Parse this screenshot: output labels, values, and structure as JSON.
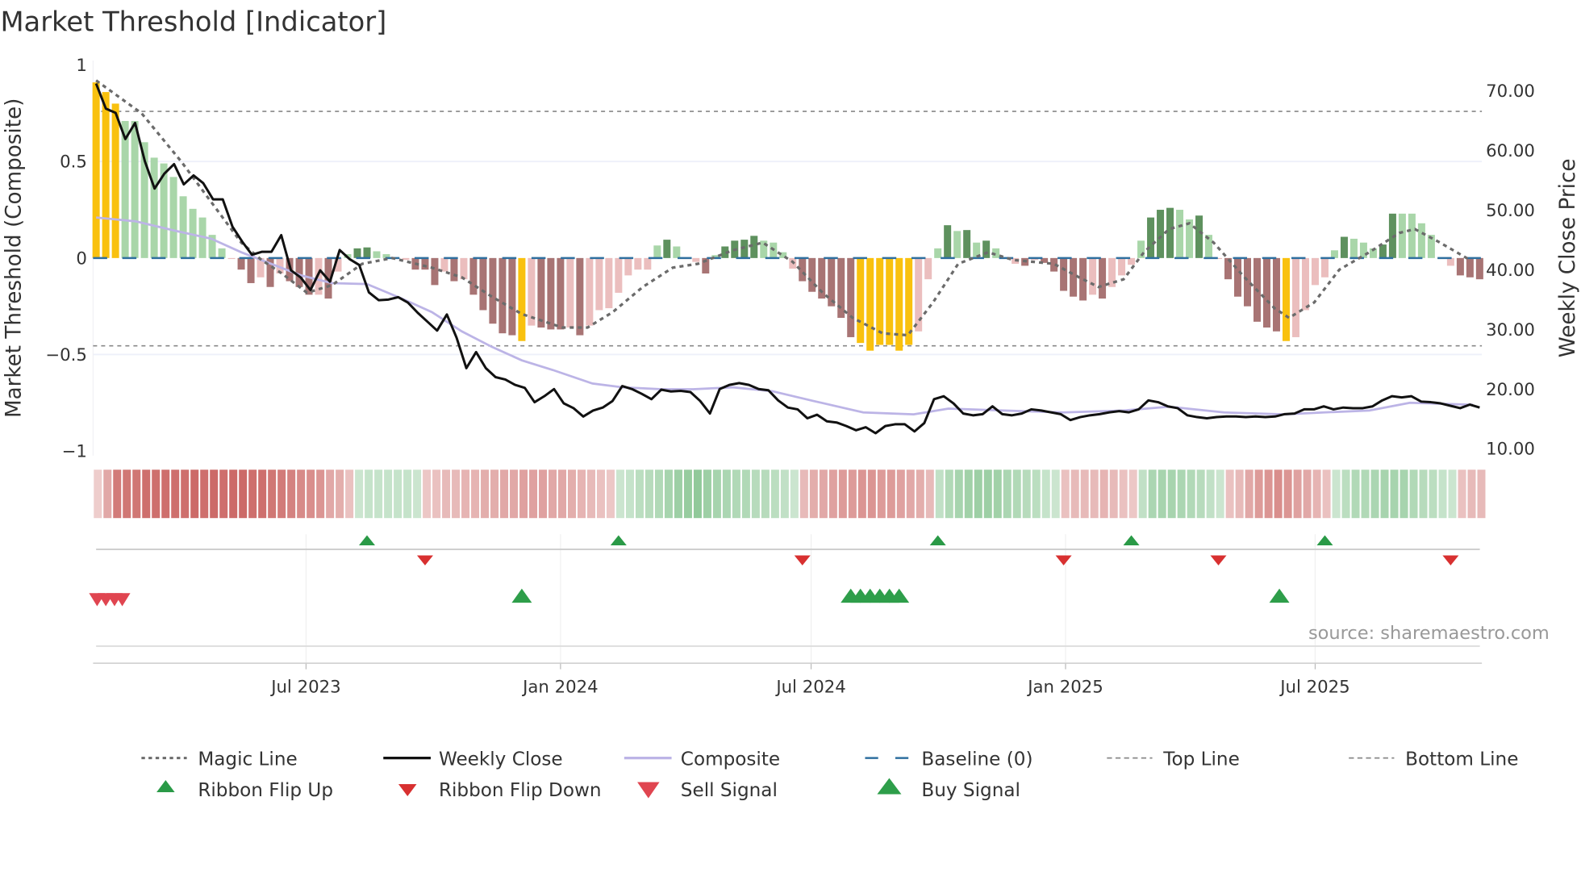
{
  "chart_data": {
    "type": "bar",
    "title": "Market Threshold [Indicator]",
    "ylabel_left": "Market Threshold (Composite)",
    "ylabel_right": "Weekly Close Price",
    "ylim_left": [
      -1,
      1
    ],
    "ylim_right": [
      10,
      73
    ],
    "left_ticks": [
      "1",
      "0.5",
      "0",
      "−0.5",
      "−1"
    ],
    "left_tick_values": [
      1,
      0.5,
      0,
      -0.5,
      -1
    ],
    "right_ticks": [
      "70.00",
      "60.00",
      "50.00",
      "40.00",
      "30.00",
      "20.00",
      "10.00"
    ],
    "right_tick_values": [
      70,
      60,
      50,
      40,
      30,
      20,
      10
    ],
    "x_ticks": [
      {
        "label": "Jul 2023",
        "week": 21.7
      },
      {
        "label": "Jan 2024",
        "week": 48.0
      },
      {
        "label": "Jul 2024",
        "week": 73.9
      },
      {
        "label": "Jan 2025",
        "week": 100.2
      },
      {
        "label": "Jul 2025",
        "week": 126.0
      }
    ],
    "top_line": 0.76,
    "bottom_line": -0.455,
    "baseline": 0,
    "colors": {
      "extreme": "#f9c10e",
      "strong_up": "#5e915e",
      "weak_up": "#a9d6a9",
      "strong_down": "#a87474",
      "weak_down": "#ebbebe",
      "baseline": "#2f6f9f",
      "composite": "#bcb4e6",
      "close": "#111111",
      "magic": "#6b6b6b",
      "ribbon_up": "#6fb87a",
      "ribbon_down": "#c4524f",
      "flip_up": "#2a9a47",
      "flip_down": "#d83030",
      "sell": "#e04550",
      "buy": "#2e9e4a"
    },
    "histogram_types": "Y=extreme, G=strong up, g=weak up, R=strong down, r=weak down",
    "histogram": [
      [
        0.91,
        "Y"
      ],
      [
        0.86,
        "Y"
      ],
      [
        0.8,
        "Y"
      ],
      [
        0.71,
        "g"
      ],
      [
        0.71,
        "g"
      ],
      [
        0.6,
        "g"
      ],
      [
        0.52,
        "g"
      ],
      [
        0.49,
        "g"
      ],
      [
        0.42,
        "g"
      ],
      [
        0.32,
        "g"
      ],
      [
        0.255,
        "g"
      ],
      [
        0.21,
        "g"
      ],
      [
        0.12,
        "g"
      ],
      [
        0.05,
        "g"
      ],
      [
        -0.005,
        "r"
      ],
      [
        -0.06,
        "R"
      ],
      [
        -0.13,
        "R"
      ],
      [
        -0.1,
        "r"
      ],
      [
        -0.15,
        "R"
      ],
      [
        -0.08,
        "r"
      ],
      [
        -0.12,
        "R"
      ],
      [
        -0.15,
        "R"
      ],
      [
        -0.19,
        "R"
      ],
      [
        -0.19,
        "r"
      ],
      [
        -0.21,
        "R"
      ],
      [
        -0.07,
        "r"
      ],
      [
        0.02,
        "g"
      ],
      [
        0.05,
        "G"
      ],
      [
        0.055,
        "G"
      ],
      [
        0.035,
        "g"
      ],
      [
        0.02,
        "g"
      ],
      [
        -0.005,
        "r"
      ],
      [
        -0.01,
        "r"
      ],
      [
        -0.06,
        "R"
      ],
      [
        -0.06,
        "R"
      ],
      [
        -0.14,
        "R"
      ],
      [
        -0.07,
        "r"
      ],
      [
        -0.12,
        "R"
      ],
      [
        -0.11,
        "r"
      ],
      [
        -0.19,
        "R"
      ],
      [
        -0.27,
        "R"
      ],
      [
        -0.34,
        "R"
      ],
      [
        -0.39,
        "R"
      ],
      [
        -0.4,
        "R"
      ],
      [
        -0.43,
        "Y"
      ],
      [
        -0.35,
        "r"
      ],
      [
        -0.36,
        "R"
      ],
      [
        -0.37,
        "R"
      ],
      [
        -0.37,
        "R"
      ],
      [
        -0.36,
        "r"
      ],
      [
        -0.4,
        "R"
      ],
      [
        -0.35,
        "r"
      ],
      [
        -0.27,
        "r"
      ],
      [
        -0.26,
        "r"
      ],
      [
        -0.18,
        "r"
      ],
      [
        -0.09,
        "r"
      ],
      [
        -0.06,
        "r"
      ],
      [
        -0.06,
        "r"
      ],
      [
        0.065,
        "g"
      ],
      [
        0.095,
        "G"
      ],
      [
        0.06,
        "g"
      ],
      [
        -0.005,
        "r"
      ],
      [
        -0.02,
        "r"
      ],
      [
        -0.08,
        "R"
      ],
      [
        0.015,
        "g"
      ],
      [
        0.06,
        "G"
      ],
      [
        0.09,
        "G"
      ],
      [
        0.095,
        "G"
      ],
      [
        0.115,
        "G"
      ],
      [
        0.09,
        "g"
      ],
      [
        0.08,
        "g"
      ],
      [
        0.03,
        "g"
      ],
      [
        -0.055,
        "r"
      ],
      [
        -0.12,
        "R"
      ],
      [
        -0.175,
        "R"
      ],
      [
        -0.21,
        "R"
      ],
      [
        -0.25,
        "R"
      ],
      [
        -0.31,
        "R"
      ],
      [
        -0.41,
        "R"
      ],
      [
        -0.44,
        "Y"
      ],
      [
        -0.48,
        "Y"
      ],
      [
        -0.45,
        "Y"
      ],
      [
        -0.45,
        "Y"
      ],
      [
        -0.48,
        "Y"
      ],
      [
        -0.45,
        "Y"
      ],
      [
        -0.38,
        "r"
      ],
      [
        -0.11,
        "r"
      ],
      [
        0.05,
        "g"
      ],
      [
        0.17,
        "G"
      ],
      [
        0.14,
        "g"
      ],
      [
        0.145,
        "G"
      ],
      [
        0.08,
        "g"
      ],
      [
        0.09,
        "G"
      ],
      [
        0.05,
        "g"
      ],
      [
        -0.005,
        "r"
      ],
      [
        -0.03,
        "r"
      ],
      [
        -0.04,
        "R"
      ],
      [
        -0.01,
        "r"
      ],
      [
        -0.025,
        "R"
      ],
      [
        -0.07,
        "R"
      ],
      [
        -0.17,
        "R"
      ],
      [
        -0.2,
        "R"
      ],
      [
        -0.22,
        "R"
      ],
      [
        -0.19,
        "r"
      ],
      [
        -0.21,
        "R"
      ],
      [
        -0.15,
        "r"
      ],
      [
        -0.09,
        "r"
      ],
      [
        -0.035,
        "r"
      ],
      [
        0.09,
        "g"
      ],
      [
        0.21,
        "G"
      ],
      [
        0.25,
        "G"
      ],
      [
        0.26,
        "G"
      ],
      [
        0.25,
        "g"
      ],
      [
        0.2,
        "g"
      ],
      [
        0.22,
        "G"
      ],
      [
        0.12,
        "g"
      ],
      [
        -0.005,
        "r"
      ],
      [
        -0.11,
        "R"
      ],
      [
        -0.2,
        "R"
      ],
      [
        -0.25,
        "R"
      ],
      [
        -0.33,
        "R"
      ],
      [
        -0.36,
        "R"
      ],
      [
        -0.38,
        "R"
      ],
      [
        -0.43,
        "Y"
      ],
      [
        -0.41,
        "r"
      ],
      [
        -0.27,
        "r"
      ],
      [
        -0.14,
        "r"
      ],
      [
        -0.1,
        "r"
      ],
      [
        0.04,
        "g"
      ],
      [
        0.11,
        "G"
      ],
      [
        0.1,
        "g"
      ],
      [
        0.08,
        "g"
      ],
      [
        0.05,
        "g"
      ],
      [
        0.07,
        "G"
      ],
      [
        0.23,
        "G"
      ],
      [
        0.23,
        "g"
      ],
      [
        0.23,
        "g"
      ],
      [
        0.18,
        "g"
      ],
      [
        0.12,
        "g"
      ],
      [
        -0.005,
        "r"
      ],
      [
        -0.04,
        "r"
      ],
      [
        -0.09,
        "R"
      ],
      [
        -0.1,
        "R"
      ],
      [
        -0.11,
        "R"
      ]
    ],
    "weekly_close": [
      71.2,
      67,
      66.3,
      61.9,
      64.6,
      58.2,
      53.6,
      56.1,
      57.7,
      54.3,
      55.8,
      54.5,
      51.8,
      51.8,
      47.2,
      44.7,
      42.5,
      43,
      43,
      45.8,
      39.9,
      38.7,
      36.6,
      39.9,
      38,
      43.3,
      41.8,
      40.8,
      36.2,
      34.9,
      35,
      35.4,
      34.5,
      32.8,
      31.3,
      29.8,
      32.5,
      28.6,
      23.5,
      26.2,
      23.5,
      22,
      21.6,
      20.7,
      20.2,
      17.8,
      18.8,
      20,
      17.6,
      16.8,
      15.4,
      16.4,
      16.9,
      18,
      20.5,
      20,
      19.2,
      18.3,
      19.9,
      19.6,
      19.7,
      19.5,
      18,
      15.9,
      20,
      20.7,
      21,
      20.7,
      20,
      19.8,
      18.1,
      16.9,
      16.6,
      15.1,
      15.7,
      14.6,
      14.4,
      13.8,
      13.1,
      13.6,
      12.6,
      13.8,
      14.1,
      14.1,
      12.9,
      14.3,
      18.3,
      18.8,
      17.6,
      15.9,
      15.6,
      15.8,
      17.1,
      15.8,
      15.6,
      15.9,
      16.6,
      16.4,
      16.1,
      15.8,
      14.8,
      15.3,
      15.6,
      15.8,
      16.1,
      16.3,
      16.1,
      16.6,
      18.1,
      17.8,
      17.1,
      16.8,
      15.6,
      15.3,
      15.1,
      15.3,
      15.4,
      15.4,
      15.3,
      15.4,
      15.3,
      15.4,
      15.8,
      15.9,
      16.6,
      16.6,
      17.1,
      16.6,
      16.9,
      16.8,
      16.8,
      17.1,
      18.1,
      18.8,
      18.6,
      18.8,
      17.9,
      17.8,
      17.6,
      17.2,
      16.8,
      17.4,
      16.9
    ],
    "composite": [
      [
        0,
        0.21
      ],
      [
        4.1,
        0.19
      ],
      [
        8.3,
        0.14
      ],
      [
        11.9,
        0.1
      ],
      [
        15,
        0.03
      ],
      [
        18.1,
        -0.03
      ],
      [
        21.2,
        -0.09
      ],
      [
        24.4,
        -0.13
      ],
      [
        27.99,
        -0.135
      ],
      [
        31.6,
        -0.21
      ],
      [
        34.7,
        -0.28
      ],
      [
        37.8,
        -0.38
      ],
      [
        40.9,
        -0.46
      ],
      [
        44,
        -0.53
      ],
      [
        47.2,
        -0.58
      ],
      [
        51.3,
        -0.65
      ],
      [
        54.4,
        -0.67
      ],
      [
        58.5,
        -0.68
      ],
      [
        61.7,
        -0.68
      ],
      [
        65.8,
        -0.67
      ],
      [
        69.9,
        -0.69
      ],
      [
        74.1,
        -0.74
      ],
      [
        79.3,
        -0.8
      ],
      [
        84.5,
        -0.81
      ],
      [
        88.1,
        -0.78
      ],
      [
        93.8,
        -0.79
      ],
      [
        100,
        -0.8
      ],
      [
        106.2,
        -0.79
      ],
      [
        110.9,
        -0.77
      ],
      [
        116.6,
        -0.8
      ],
      [
        122.8,
        -0.81
      ],
      [
        126.9,
        -0.8
      ],
      [
        131.6,
        -0.79
      ],
      [
        135.8,
        -0.75
      ],
      [
        142.3,
        -0.76
      ]
    ],
    "magic_line": [
      [
        0,
        0.92
      ],
      [
        4.7,
        0.75
      ],
      [
        8.8,
        0.5
      ],
      [
        11.9,
        0.29
      ],
      [
        15,
        0.08
      ],
      [
        17.1,
        -0.01
      ],
      [
        19.2,
        -0.08
      ],
      [
        21.8,
        -0.18
      ],
      [
        24.4,
        -0.14
      ],
      [
        27.5,
        -0.03
      ],
      [
        30.6,
        0
      ],
      [
        34.7,
        -0.05
      ],
      [
        37.8,
        -0.1
      ],
      [
        40.9,
        -0.2
      ],
      [
        44,
        -0.29
      ],
      [
        48.2,
        -0.36
      ],
      [
        50.8,
        -0.36
      ],
      [
        53.4,
        -0.28
      ],
      [
        56.5,
        -0.15
      ],
      [
        59.6,
        -0.05
      ],
      [
        62.2,
        -0.03
      ],
      [
        65.8,
        0.04
      ],
      [
        68.9,
        0.08
      ],
      [
        72,
        -0.02
      ],
      [
        75.1,
        -0.18
      ],
      [
        78.2,
        -0.31
      ],
      [
        81.3,
        -0.39
      ],
      [
        83.9,
        -0.4
      ],
      [
        86.5,
        -0.23
      ],
      [
        89.1,
        -0.03
      ],
      [
        92.2,
        0.03
      ],
      [
        94.8,
        -0.01
      ],
      [
        99,
        -0.03
      ],
      [
        101.6,
        -0.1
      ],
      [
        103.6,
        -0.15
      ],
      [
        106.2,
        -0.11
      ],
      [
        108.3,
        0.03
      ],
      [
        110.9,
        0.15
      ],
      [
        113,
        0.18
      ],
      [
        115.5,
        0.08
      ],
      [
        118.7,
        -0.1
      ],
      [
        121.8,
        -0.26
      ],
      [
        123.3,
        -0.31
      ],
      [
        125.9,
        -0.23
      ],
      [
        128.5,
        -0.06
      ],
      [
        131.6,
        0.03
      ],
      [
        134.7,
        0.13
      ],
      [
        136.3,
        0.15
      ],
      [
        138.9,
        0.08
      ],
      [
        142,
        -0.01
      ]
    ],
    "ribbon": [
      -0.15,
      -0.45,
      -0.8,
      -0.85,
      -0.85,
      -0.9,
      -0.9,
      -0.9,
      -0.9,
      -0.9,
      -0.95,
      -0.9,
      -0.95,
      -0.9,
      -0.95,
      -0.95,
      -0.9,
      -0.9,
      -0.85,
      -0.8,
      -0.75,
      -0.7,
      -0.65,
      -0.6,
      -0.45,
      -0.4,
      -0.25,
      0.25,
      0.3,
      0.3,
      0.3,
      0.3,
      0.3,
      0.25,
      -0.2,
      -0.25,
      -0.3,
      -0.3,
      -0.35,
      -0.35,
      -0.4,
      -0.4,
      -0.45,
      -0.45,
      -0.5,
      -0.5,
      -0.5,
      -0.45,
      -0.45,
      -0.4,
      -0.35,
      -0.3,
      -0.25,
      -0.2,
      0.25,
      0.3,
      0.4,
      0.45,
      0.5,
      0.6,
      0.7,
      0.75,
      0.8,
      0.7,
      0.6,
      0.55,
      0.5,
      0.5,
      0.45,
      0.45,
      0.4,
      0.35,
      0.25,
      -0.3,
      -0.4,
      -0.45,
      -0.5,
      -0.55,
      -0.55,
      -0.6,
      -0.6,
      -0.55,
      -0.55,
      -0.5,
      -0.45,
      -0.4,
      -0.3,
      0.35,
      0.5,
      0.6,
      0.65,
      0.7,
      0.7,
      0.65,
      0.55,
      0.5,
      0.45,
      0.4,
      0.3,
      0.25,
      -0.25,
      -0.3,
      -0.3,
      -0.3,
      -0.35,
      -0.3,
      -0.25,
      -0.2,
      0.35,
      0.55,
      0.6,
      0.6,
      0.55,
      0.5,
      0.45,
      0.35,
      0.25,
      -0.25,
      -0.3,
      -0.45,
      -0.55,
      -0.6,
      -0.65,
      -0.6,
      -0.5,
      -0.45,
      -0.35,
      -0.25,
      0.25,
      0.4,
      0.5,
      0.5,
      0.55,
      0.6,
      0.6,
      0.6,
      0.5,
      0.45,
      0.4,
      0.3,
      0.25,
      -0.25,
      -0.3,
      -0.3
    ],
    "signals": {
      "ribbon_flip_up": [
        28,
        54,
        87,
        107,
        127
      ],
      "ribbon_flip_down": [
        34,
        73,
        100,
        116,
        140
      ],
      "sell": [
        0,
        0.9,
        1.8,
        2.6
      ],
      "buy": [
        44,
        78,
        79,
        80,
        81,
        82,
        83,
        122.3
      ]
    },
    "legend": [
      {
        "label": "Magic Line",
        "kind": "dotted"
      },
      {
        "label": "Weekly Close",
        "kind": "solid-black"
      },
      {
        "label": "Composite",
        "kind": "solid-lavender"
      },
      {
        "label": "Baseline (0)",
        "kind": "dashed-blue"
      },
      {
        "label": "Top Line",
        "kind": "dashed-grey"
      },
      {
        "label": "Bottom Line",
        "kind": "dashed-grey"
      },
      {
        "label": "Ribbon Flip Up",
        "kind": "tri-up-small"
      },
      {
        "label": "Ribbon Flip Down",
        "kind": "tri-down-small"
      },
      {
        "label": "Sell Signal",
        "kind": "tri-down-big"
      },
      {
        "label": "Buy Signal",
        "kind": "tri-up-big"
      }
    ],
    "legend_position": "bottom",
    "source": "source: sharemaestro.com"
  }
}
